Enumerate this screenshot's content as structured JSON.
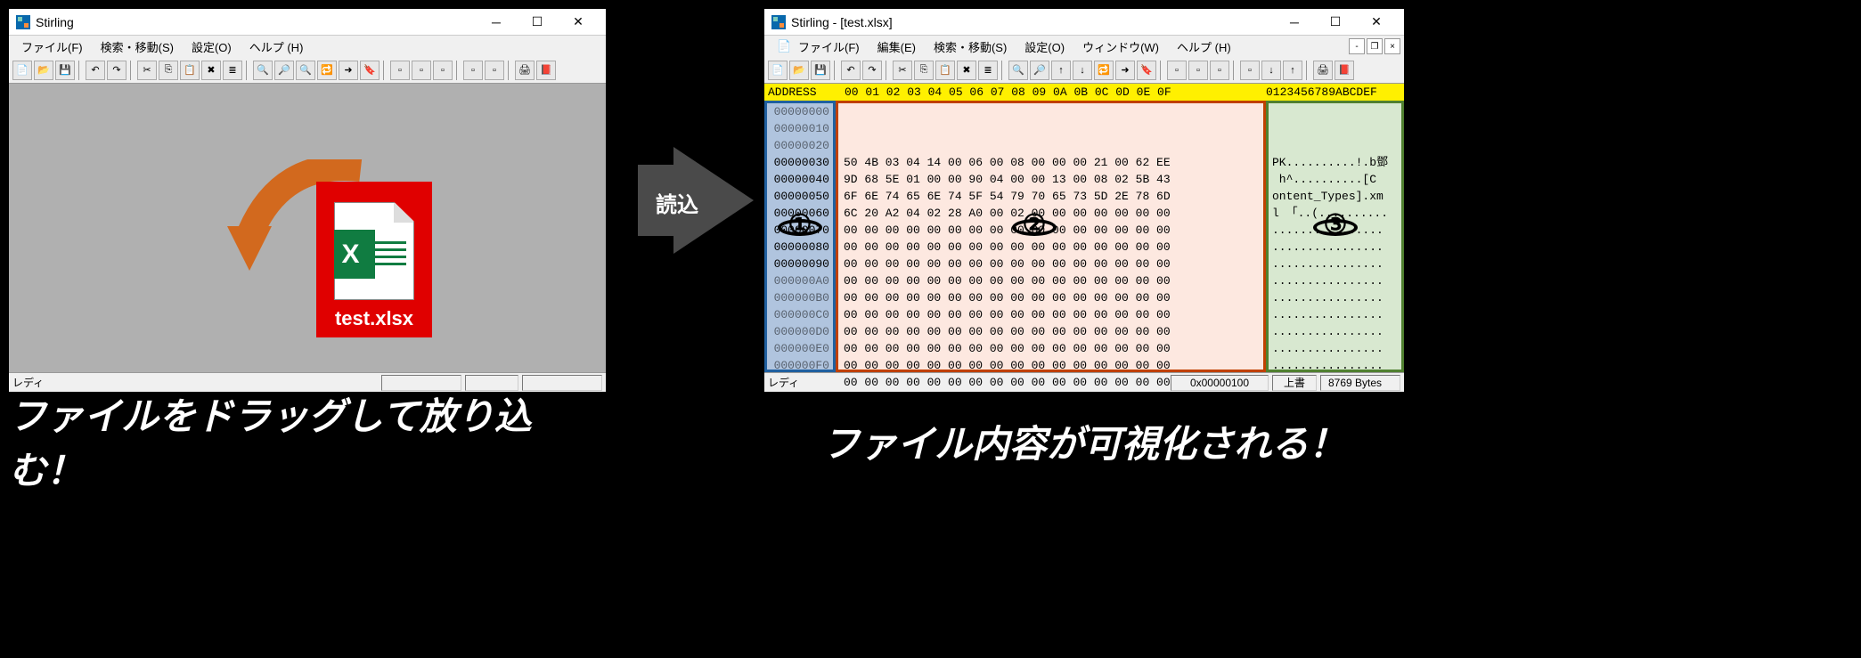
{
  "left": {
    "title": "Stirling",
    "menu": [
      "ファイル(F)",
      "検索・移動(S)",
      "設定(O)",
      "ヘルプ (H)"
    ],
    "status": "レディ"
  },
  "right": {
    "title": "Stirling - [test.xlsx]",
    "menu": [
      "ファイル(F)",
      "編集(E)",
      "検索・移動(S)",
      "設定(O)",
      "ウィンドウ(W)",
      "ヘルプ (H)"
    ],
    "status": "レディ",
    "cursor": "0x00000100",
    "mode": "上書",
    "size": "8769 Bytes"
  },
  "file": {
    "name": "test.xlsx"
  },
  "arrow_label": "読込",
  "hex": {
    "header": {
      "addr": "ADDRESS",
      "bytes": "00 01 02 03 04 05 06 07 08 09 0A 0B 0C 0D 0E 0F",
      "ascii": "0123456789ABCDEF"
    },
    "addresses": [
      "00000000",
      "00000010",
      "00000020",
      "00000030",
      "00000040",
      "00000050",
      "00000060",
      "00000070",
      "00000080",
      "00000090",
      "000000A0",
      "000000B0",
      "000000C0",
      "000000D0",
      "000000E0",
      "000000F0"
    ],
    "bytes": [
      "50 4B 03 04 14 00 06 00 08 00 00 00 21 00 62 EE",
      "9D 68 5E 01 00 00 90 04 00 00 13 00 08 02 5B 43",
      "6F 6E 74 65 6E 74 5F 54 79 70 65 73 5D 2E 78 6D",
      "6C 20 A2 04 02 28 A0 00 02 00 00 00 00 00 00 00",
      "00 00 00 00 00 00 00 00 00 00 00 00 00 00 00 00",
      "00 00 00 00 00 00 00 00 00 00 00 00 00 00 00 00",
      "00 00 00 00 00 00 00 00 00 00 00 00 00 00 00 00",
      "00 00 00 00 00 00 00 00 00 00 00 00 00 00 00 00",
      "00 00 00 00 00 00 00 00 00 00 00 00 00 00 00 00",
      "00 00 00 00 00 00 00 00 00 00 00 00 00 00 00 00",
      "00 00 00 00 00 00 00 00 00 00 00 00 00 00 00 00",
      "00 00 00 00 00 00 00 00 00 00 00 00 00 00 00 00",
      "00 00 00 00 00 00 00 00 00 00 00 00 00 00 00 00",
      "00 00 00 00 00 00 00 00 00 00 00 00 00 00 00 00",
      "00 00 00 00 00 00 00 00 00 00 00 00 00 00 00 00",
      "00 00 00 00 00 00 00 00 00 00 00 00 00 00 00 00"
    ],
    "ascii": [
      "PK..........!.b鄧",
      " h^..........[C",
      "ontent_Types].xm",
      "l 「..(..........",
      "................",
      "................",
      "................",
      "................",
      "................",
      "................",
      "................",
      "................",
      "................",
      "................",
      "................",
      "................"
    ]
  },
  "annotations": {
    "n1": "①",
    "n2": "②",
    "n3": "③"
  },
  "captions": {
    "left": "ファイルをドラッグして放り込む！",
    "right": "ファイル内容が可視化される！"
  }
}
